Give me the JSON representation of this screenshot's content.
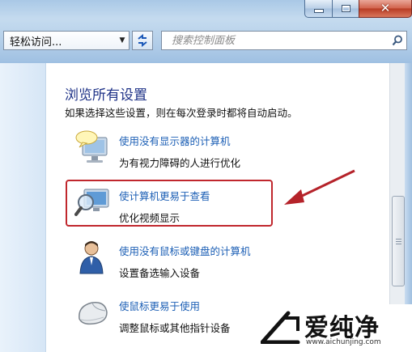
{
  "window": {
    "controls": [
      "minimize-icon",
      "maximize-icon",
      "close-icon"
    ]
  },
  "toolbar": {
    "address": "轻松访问...",
    "search_placeholder": "搜索控制面板"
  },
  "content": {
    "title": "浏览所有设置",
    "subtitle": "如果选择这些设置，则在每次登录时都将自动启动。",
    "items": [
      {
        "link": "使用没有显示器的计算机",
        "desc": "为有视力障碍的人进行优化",
        "icon": "speech-monitor-icon"
      },
      {
        "link": "使计算机更易于查看",
        "desc": "优化视频显示",
        "icon": "magnifier-monitor-icon",
        "highlighted": true
      },
      {
        "link": "使用没有鼠标或键盘的计算机",
        "desc": "设置备选输入设备",
        "icon": "user-icon"
      },
      {
        "link": "使鼠标更易于使用",
        "desc": "调整鼠标或其他指针设备",
        "icon": "mouse-icon"
      }
    ]
  },
  "annotation": {
    "highlight_color": "#c0272d",
    "arrow_color": "#b5232a"
  },
  "watermark": {
    "name": "爱纯净",
    "url": "www.aichunjing.com"
  },
  "colors": {
    "link": "#1c5fb5",
    "title": "#1e3287"
  }
}
